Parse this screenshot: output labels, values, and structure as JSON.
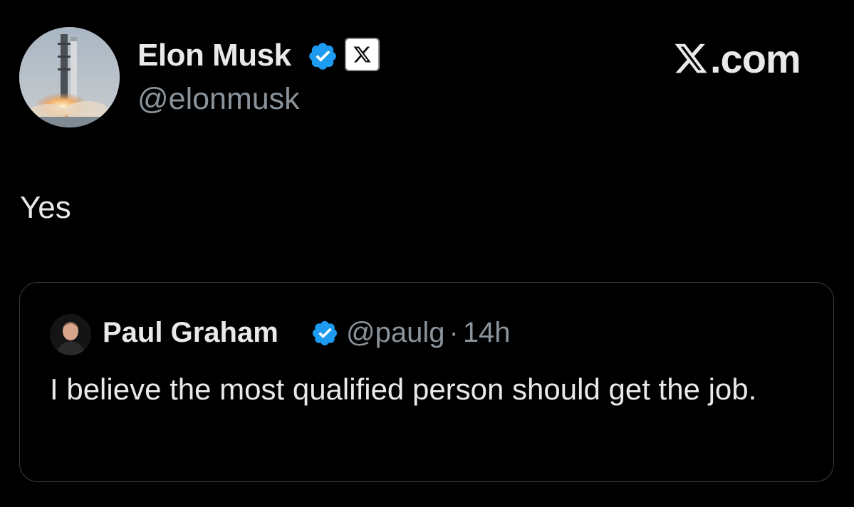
{
  "post": {
    "author": {
      "display_name": "Elon Musk",
      "handle": "@elonmusk",
      "verified": true,
      "affiliation_badge": "x-logo-icon"
    },
    "text": "Yes"
  },
  "watermark": {
    "logo": "x-logo-icon",
    "text": ".com"
  },
  "quoted_post": {
    "author": {
      "display_name": "Paul Graham",
      "handle": "@paulg",
      "verified": true
    },
    "separator": "·",
    "timestamp": "14h",
    "text": "I believe the most qualified person should get the job."
  },
  "colors": {
    "background": "#000000",
    "primary_text": "#e7e9ea",
    "secondary_text": "#8b939b",
    "verified_blue": "#1d9bf0",
    "card_border": "#3a3d40"
  }
}
